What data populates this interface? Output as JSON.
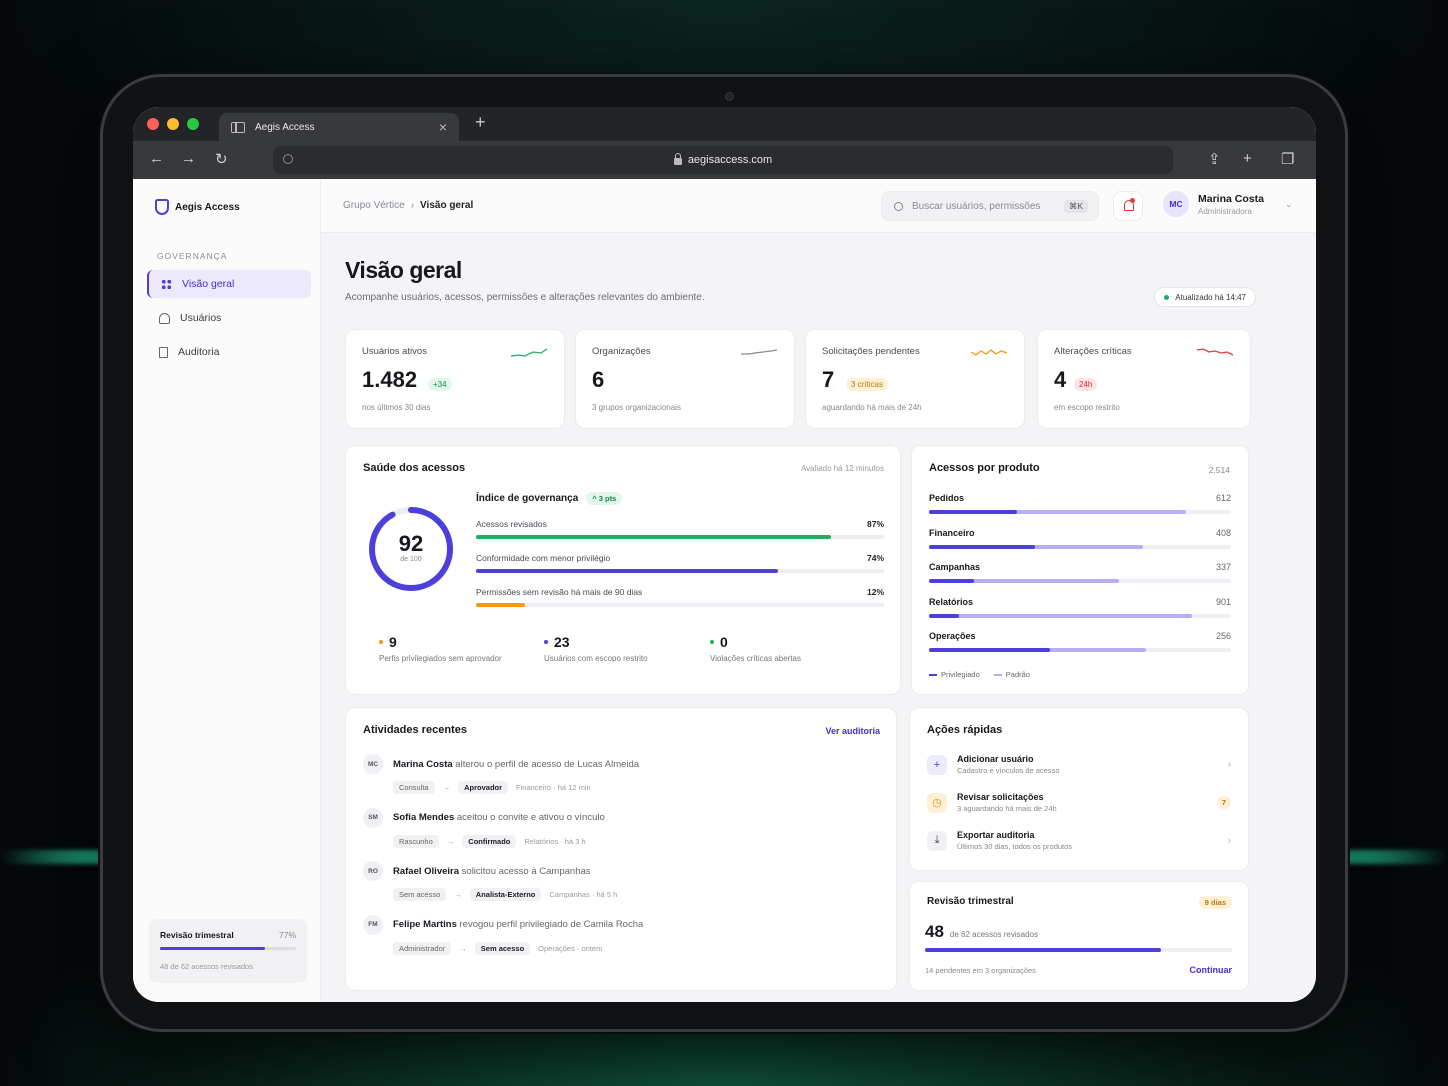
{
  "browser": {
    "tab_title": "Aegis Access",
    "url": "aegisaccess.com"
  },
  "brand": {
    "name": "Aegis Access"
  },
  "sidebar": {
    "section": "GOVERNANÇA",
    "items": [
      {
        "label": "Visão geral",
        "icon": "grid-icon",
        "active": true
      },
      {
        "label": "Usuários",
        "icon": "users-icon",
        "active": false
      },
      {
        "label": "Auditoria",
        "icon": "document-icon",
        "active": false
      }
    ],
    "review": {
      "title": "Revisão trimestral",
      "percent": "77%",
      "progress": 0.77,
      "subtitle": "48 de 62 acessos revisados"
    }
  },
  "header": {
    "breadcrumb": [
      "Grupo Vértice",
      "Visão geral"
    ],
    "search_placeholder": "Buscar usuários, permissões",
    "shortcut": "⌘K",
    "user": {
      "initials": "MC",
      "name": "Marina Costa",
      "role": "Administradora"
    }
  },
  "page": {
    "title": "Visão geral",
    "subtitle": "Acompanhe usuários, acessos, permissões e alterações relevantes do ambiente.",
    "updated": "Atualizado há 14:47"
  },
  "kpis": [
    {
      "label": "Usuários ativos",
      "value": "1.482",
      "badge": "+34",
      "sub": "nos últimos 30 dias",
      "color": "#1fae63"
    },
    {
      "label": "Organizações",
      "value": "6",
      "badge": "",
      "sub": "3 grupos organizacionais",
      "color": "#8a8a95"
    },
    {
      "label": "Solicitações pendentes",
      "value": "7",
      "badge": "3 críticas",
      "sub": "aguardando há mais de 24h",
      "color": "#f29a12"
    },
    {
      "label": "Alterações críticas",
      "value": "4",
      "badge": "24h",
      "sub": "em escopo restrito",
      "color": "#e23a3a"
    }
  ],
  "health": {
    "title": "Saúde dos acessos",
    "evaluated": "Avaliado há 12 minutos",
    "score": "92",
    "score_of": "de 100",
    "score_value": 92,
    "index_label": "Índice de governança",
    "index_delta": "^ 3 pts",
    "metrics": [
      {
        "label": "Acessos revisados",
        "value": "87%",
        "fill": 0.87,
        "color": "#1fae63"
      },
      {
        "label": "Conformidade com menor privilégio",
        "value": "74%",
        "fill": 0.74,
        "color": "#4c3fdc"
      },
      {
        "label": "Permissões sem revisão há mais de 90 dias",
        "value": "12%",
        "fill": 0.12,
        "color": "#f29a12"
      }
    ],
    "stats": [
      {
        "value": "9",
        "label": "Perfis privilegiados sem aprovador",
        "color": "#f29a12"
      },
      {
        "value": "23",
        "label": "Usuários com escopo restrito",
        "color": "#4c3fdc"
      },
      {
        "value": "0",
        "label": "Violações críticas abertas",
        "color": "#1fae63"
      }
    ]
  },
  "products": {
    "title": "Acessos por produto",
    "total": "2.514",
    "items": [
      {
        "name": "Pedidos",
        "value": "612",
        "privileged": 0.29,
        "total": 0.85
      },
      {
        "name": "Financeiro",
        "value": "408",
        "privileged": 0.35,
        "total": 0.71
      },
      {
        "name": "Campanhas",
        "value": "337",
        "privileged": 0.15,
        "total": 0.63
      },
      {
        "name": "Relatórios",
        "value": "901",
        "privileged": 0.1,
        "total": 0.87
      },
      {
        "name": "Operações",
        "value": "256",
        "privileged": 0.4,
        "total": 0.72
      }
    ],
    "legend": [
      {
        "label": "Privilegiado",
        "color": "#4c3fdc"
      },
      {
        "label": "Padrão",
        "color": "#b6adf4"
      }
    ]
  },
  "activities": {
    "title": "Atividades recentes",
    "link": "Ver auditoria",
    "items": [
      {
        "initials": "MC",
        "name": "Marina Costa",
        "text": "alterou o perfil de acesso de Lucas Almeida",
        "from": "Consulta",
        "to": "Aprovador",
        "meta": "Financeiro · há 12 min"
      },
      {
        "initials": "SM",
        "name": "Sofia Mendes",
        "text": "aceitou o convite e ativou o vínculo",
        "from": "Rascunho",
        "to": "Confirmado",
        "meta": "Relatórios · há 3 h"
      },
      {
        "initials": "RO",
        "name": "Rafael Oliveira",
        "text": "solicitou acesso à Campanhas",
        "from": "Sem acesso",
        "to": "Analista-Externo",
        "meta": "Campanhas · há 5 h"
      },
      {
        "initials": "FM",
        "name": "Felipe Martins",
        "text": "revogou perfil privilegiado de Camila Rocha",
        "from": "Administrador",
        "to": "Sem acesso",
        "meta": "Operações · ontem"
      }
    ]
  },
  "quick_actions": {
    "title": "Ações rápidas",
    "items": [
      {
        "title": "Adicionar usuário",
        "desc": "Cadastro e vínculos de acesso",
        "icon": "plus-icon",
        "count": ""
      },
      {
        "title": "Revisar solicitações",
        "desc": "3 aguardando há mais de 24h",
        "icon": "clock-icon",
        "count": "7"
      },
      {
        "title": "Exportar auditoria",
        "desc": "Últimos 30 dias, todos os produtos",
        "icon": "download-icon",
        "count": ""
      }
    ]
  },
  "quarterly": {
    "title": "Revisão trimestral",
    "badge": "9 dias",
    "value": "48",
    "value_sub": "de 62 acessos revisados",
    "progress": 0.77,
    "footer": "14 pendentes em 3 organizações",
    "link": "Continuar"
  }
}
